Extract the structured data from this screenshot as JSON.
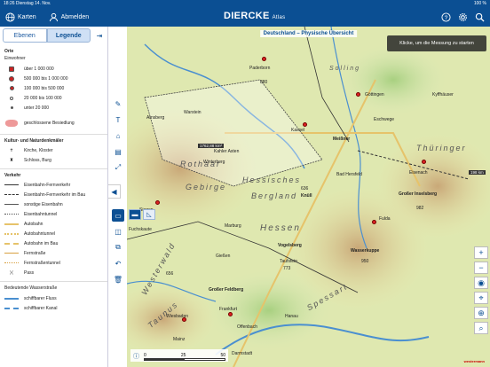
{
  "status": {
    "time": "18:26",
    "date": "Dienstag 14. Nov.",
    "battery": "100 %"
  },
  "topbar": {
    "karten_label": "Karten",
    "abmelden_label": "Abmelden",
    "brand": "DIERCKE",
    "brand_sub": "Atlas"
  },
  "sidebar": {
    "tab_ebenen": "Ebenen",
    "tab_legende": "Legende",
    "legend": {
      "orte_title": "Orte",
      "einwohner": "Einwohner",
      "einwohner_items": [
        "über 1 000 000",
        "500 000 bis 1 000 000",
        "100 000 bis 500 000",
        "20 000 bis 100 000",
        "unter 20 000"
      ],
      "besiedlung": "geschlossene Besiedlung",
      "kultur_title": "Kultur- und Naturdenkmäler",
      "kultur_items": [
        "Kirche, Kloster",
        "Schloss, Burg"
      ],
      "verkehr_title": "Verkehr",
      "verkehr_items": [
        "Eisenbahn-Fernverkehr",
        "Eisenbahn-Fernverkehr im Bau",
        "sonstige Eisenbahn",
        "Eisenbahntunnel",
        "Autobahn",
        "Autobahntunnel",
        "Autobahn im Bau",
        "Fernstraße",
        "Fernstraßentunnel",
        "Pass"
      ],
      "wasser_title": "Bedeutende Wasserstraße",
      "wasser_items": [
        "schiffbarer Fluss",
        "schiffbarer Kanal"
      ]
    }
  },
  "map": {
    "title": "Deutschland – Physische Übersicht",
    "hint": "Klicke, um die Messung zu starten",
    "measure_1": "1762,88 km²",
    "measure_2": "198 km",
    "places": [
      "Paderborn",
      "Solling",
      "Göttingen",
      "Kassel",
      "Meißner",
      "Rothaar",
      "Gebirge",
      "Hessisches",
      "Bergland",
      "Knüll",
      "Wasserkuppe",
      "Vogelsberg",
      "Taufstein",
      "Großer Feldberg",
      "Frankfurt",
      "Wiesbaden",
      "Offenbach",
      "Darmstadt",
      "Mainz",
      "Siegen",
      "Fuchskaute",
      "Warstein",
      "Arnsberg",
      "Winterberg",
      "Kahler Asten",
      "Thüringer",
      "Großer Inselsberg",
      "Eisenach",
      "Fulda",
      "Marburg",
      "Gießen",
      "Hanau",
      "Spessart",
      "Westerwald",
      "Taunus",
      "Hessen",
      "Kyffhäuser",
      "Eschwege",
      "Bad Hersfeld"
    ],
    "heights": [
      "636",
      "950",
      "773",
      "982",
      "656",
      "880"
    ],
    "scale": [
      "0",
      "25",
      "50"
    ],
    "publisher": "westermann"
  }
}
